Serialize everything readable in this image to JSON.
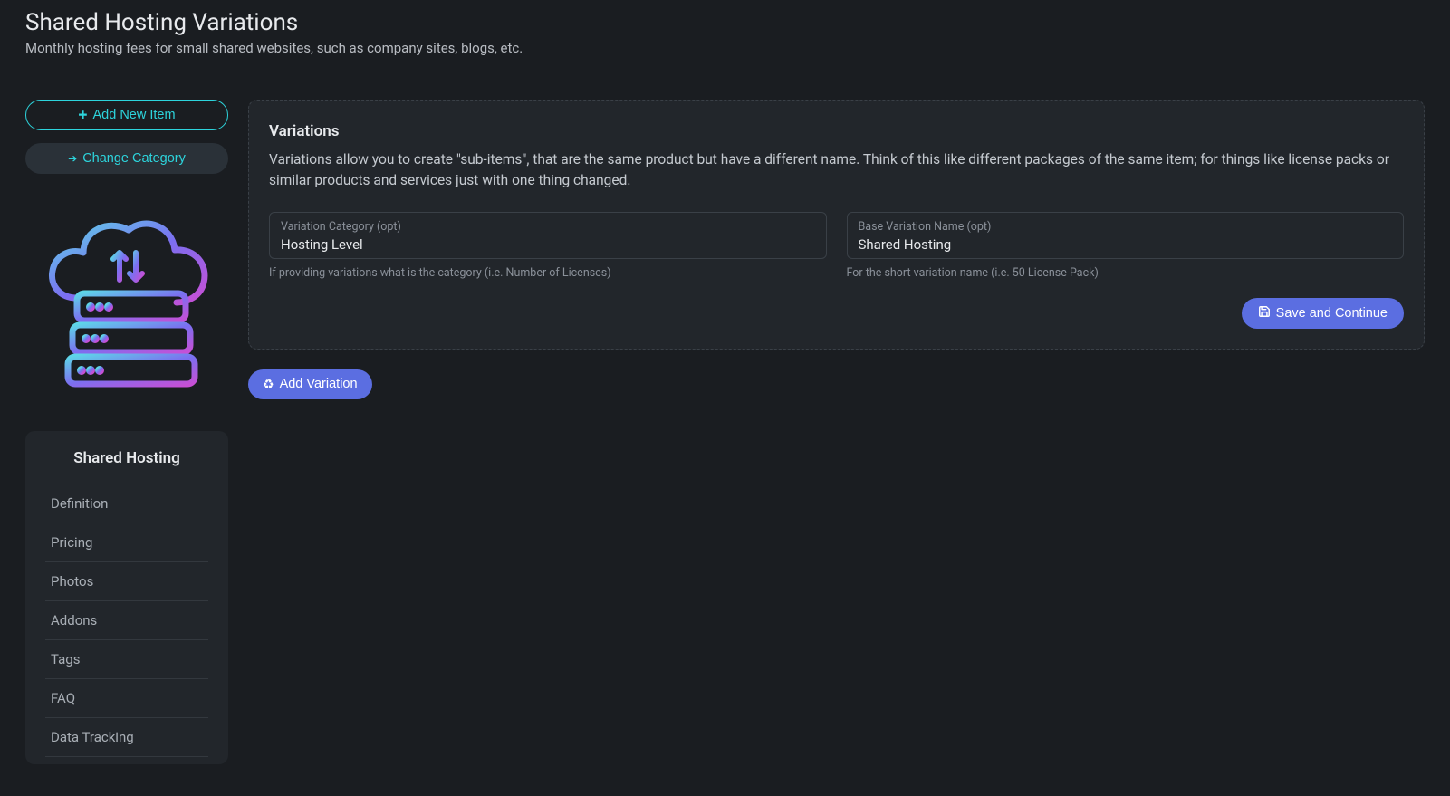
{
  "header": {
    "title": "Shared Hosting Variations",
    "subtitle": "Monthly hosting fees for small shared websites, such as company sites, blogs, etc."
  },
  "sidebar": {
    "add_new_label": "Add New Item",
    "change_category_label": "Change Category",
    "panel_title": "Shared Hosting",
    "nav_items": [
      "Definition",
      "Pricing",
      "Photos",
      "Addons",
      "Tags",
      "FAQ",
      "Data Tracking"
    ]
  },
  "main": {
    "card_title": "Variations",
    "card_desc": "Variations allow you to create \"sub-items\", that are the same product but have a different name. Think of this like different packages of the same item; for things like license packs or similar products and services just with one thing changed.",
    "variation_category": {
      "label": "Variation Category (opt)",
      "value": "Hosting Level",
      "hint": "If providing variations what is the category (i.e. Number of Licenses)"
    },
    "base_variation_name": {
      "label": "Base Variation Name (opt)",
      "value": "Shared Hosting",
      "hint": "For the short variation name (i.e. 50 License Pack)"
    },
    "save_continue_label": "Save and Continue",
    "add_variation_label": "Add Variation"
  }
}
